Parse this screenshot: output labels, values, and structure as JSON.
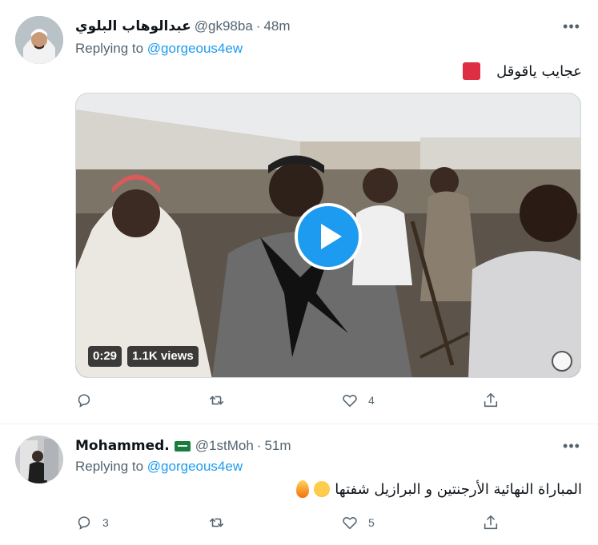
{
  "tweets": [
    {
      "name": "عبدالوهاب البلوي",
      "handle": "@gk98ba",
      "dot": "·",
      "time": "48m",
      "replying_prefix": "Replying to ",
      "replying_to": "@gorgeous4ew",
      "text": "عجايب ياقوقل",
      "media": {
        "duration": "0:29",
        "views": "1.1K views"
      },
      "actions": {
        "reply_count": "",
        "retweet_count": "",
        "like_count": "4"
      },
      "more_label": "•••"
    },
    {
      "name": "Mohammed.",
      "handle": "@1stMoh",
      "dot": "·",
      "time": "51m",
      "replying_prefix": "Replying to ",
      "replying_to": "@gorgeous4ew",
      "text": "المباراة النهائية الأرجنتين و البرازيل شفتها",
      "actions": {
        "reply_count": "3",
        "retweet_count": "",
        "like_count": "5"
      },
      "more_label": "•••"
    }
  ],
  "colors": {
    "accent": "#1d9bf0",
    "secondary_text": "#536471",
    "primary_text": "#0f1419",
    "divider": "#eff3f4"
  },
  "icons": [
    "reply-icon",
    "retweet-icon",
    "like-icon",
    "share-icon",
    "more-icon",
    "play-icon",
    "saudi-flag-icon",
    "red-square-icon",
    "star-struck-icon",
    "fire-icon"
  ]
}
